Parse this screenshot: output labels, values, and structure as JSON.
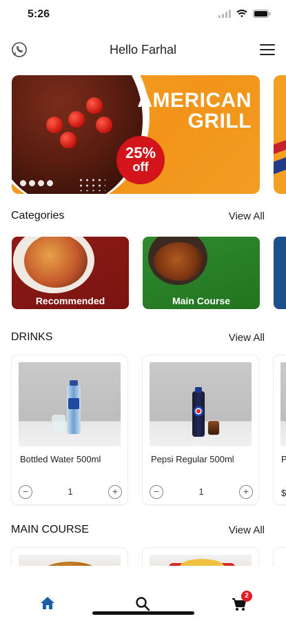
{
  "status_bar": {
    "time": "5:26"
  },
  "header": {
    "greeting": "Hello Farhal"
  },
  "banner": {
    "headline_line1": "AMERICAN",
    "headline_line2": "GRILL",
    "discount_pct": "25%",
    "discount_off": "off"
  },
  "categories": {
    "title": "Categories",
    "view_all": "View All",
    "items": [
      {
        "label": "Recommended"
      },
      {
        "label": "Main Course"
      }
    ]
  },
  "drinks": {
    "title": "DRINKS",
    "view_all": "View All",
    "items": [
      {
        "name": "Bottled Water 500ml",
        "qty": "1"
      },
      {
        "name": "Pepsi Regular 500ml",
        "qty": "1"
      }
    ],
    "peek_name": "P",
    "peek_price": "$"
  },
  "main_course": {
    "title": "MAIN COURSE",
    "view_all": "View All"
  },
  "tabbar": {
    "cart_count": "2",
    "accent": "#1b5fa8"
  },
  "icons": {
    "whatsapp": "whatsapp-icon",
    "menu": "menu-icon",
    "home": "home-icon",
    "search": "search-icon",
    "cart": "cart-icon"
  }
}
